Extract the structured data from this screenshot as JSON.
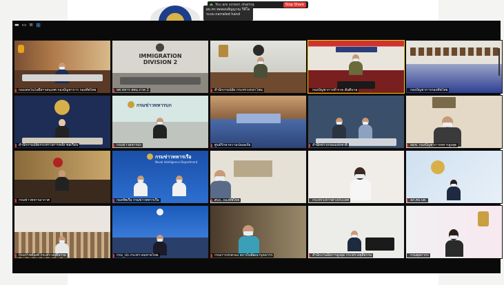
{
  "share": {
    "text": "You are screen sharing",
    "stop_label": "Stop Share",
    "tooltip_line1": "ผบ.ทร.ทดสอบสัญญาณ  วีดีโอ",
    "tooltip_line2": "ระบบ narrated  hand"
  },
  "toolbar": {
    "icons": [
      "minimize-icon",
      "restore-icon",
      "close-icon",
      "gallery-view-icon"
    ]
  },
  "participants": [
    {
      "name": "กองเทคโนโลยีสารสนเทศ กองบัญชาการ กองทัพไทย",
      "muted": true
    },
    {
      "name": "ยศ.ทหาร สตม.ภาค 2",
      "muted": true
    },
    {
      "name": "สำนักงานปลัด กระทรวงกลาโหม",
      "muted": true
    },
    {
      "name": "กองบัญชาการตำรวจ สันติบาล",
      "muted": false
    },
    {
      "name": "กองบัญชาการกองทัพไทย",
      "muted": false
    },
    {
      "name": "สำนักงานปลัดกระทรวงการคลัง พลเรือน",
      "muted": true
    },
    {
      "name": "กรมข่าวทหารบก",
      "muted": true
    },
    {
      "name": "ศูนย์รักษาความปลอดภัย",
      "muted": true
    },
    {
      "name": "สำนักข่าวกรองแห่งชาติ",
      "muted": true
    },
    {
      "name": "สมช. กองบัญชาการทหารสูงสุด",
      "muted": true
    },
    {
      "name": "กรมข่าวทหารอากาศ",
      "muted": true
    },
    {
      "name": "กองทัพเรือ กรมข่าวทหารเรือ",
      "muted": true
    },
    {
      "name": "ศรภ. กองทัพไทย",
      "muted": true
    },
    {
      "name": "กระทรวงการต่างประเทศ",
      "muted": false
    },
    {
      "name": "สภ.ศอ.บต.",
      "muted": true
    },
    {
      "name": "กรมราชทัณฑ์ กระทรวงยุติธรรม",
      "muted": true
    },
    {
      "name": "กรม_ปภ.กระทรวงมหาดไทย",
      "muted": true
    },
    {
      "name": "กรมการปกครอง สถาบันพัฒนาบุคลากร",
      "muted": true
    },
    {
      "name": "สำนักงานอัยการสูงสุด กระทรวงยุติธรรม",
      "muted": true
    },
    {
      "name": "กรมศุลกากร",
      "muted": false
    }
  ],
  "signs": {
    "immigration_line1": "IMMIGRATION",
    "immigration_line2": "DIVISION 2",
    "army_intel": "กรมข่าวทหารบก",
    "navy_intel": "กรมข่าวทหารเรือ",
    "navy_intel_en": "Naval Intelligence Department"
  },
  "colors": {
    "active_speaker_border": "#f5d000",
    "muted_indicator": "#e53935",
    "stop_share": "#e53935",
    "gallery_icon": "#4aa3ff"
  }
}
